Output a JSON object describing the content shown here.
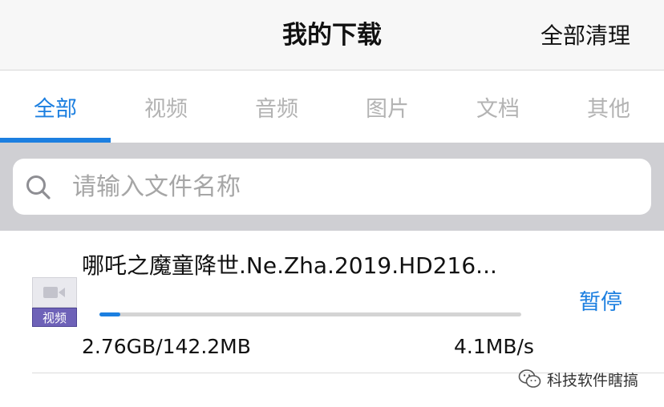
{
  "navbar": {
    "title": "我的下载",
    "action_label": "全部清理"
  },
  "tabs": [
    {
      "label": "全部",
      "active": true
    },
    {
      "label": "视频",
      "active": false
    },
    {
      "label": "音频",
      "active": false
    },
    {
      "label": "图片",
      "active": false
    },
    {
      "label": "文档",
      "active": false
    },
    {
      "label": "其他",
      "active": false
    }
  ],
  "search": {
    "placeholder": "请输入文件名称",
    "icon": "search-icon"
  },
  "downloads": [
    {
      "file_name": "哪吒之魔童降世.Ne.Zha.2019.HD216...",
      "type_tag": "视频",
      "icon": "video-camera-icon",
      "progress_fraction": 0.05,
      "size_text": "2.76GB/142.2MB",
      "speed_text": "4.1MB/s",
      "action_label": "暂停"
    }
  ],
  "watermark": {
    "text": "科技软件瞎搞",
    "icon": "wechat-icon"
  },
  "colors": {
    "accent": "#1c7fe0",
    "tag_background": "#6e62b8",
    "search_band": "#cfcfd3"
  }
}
